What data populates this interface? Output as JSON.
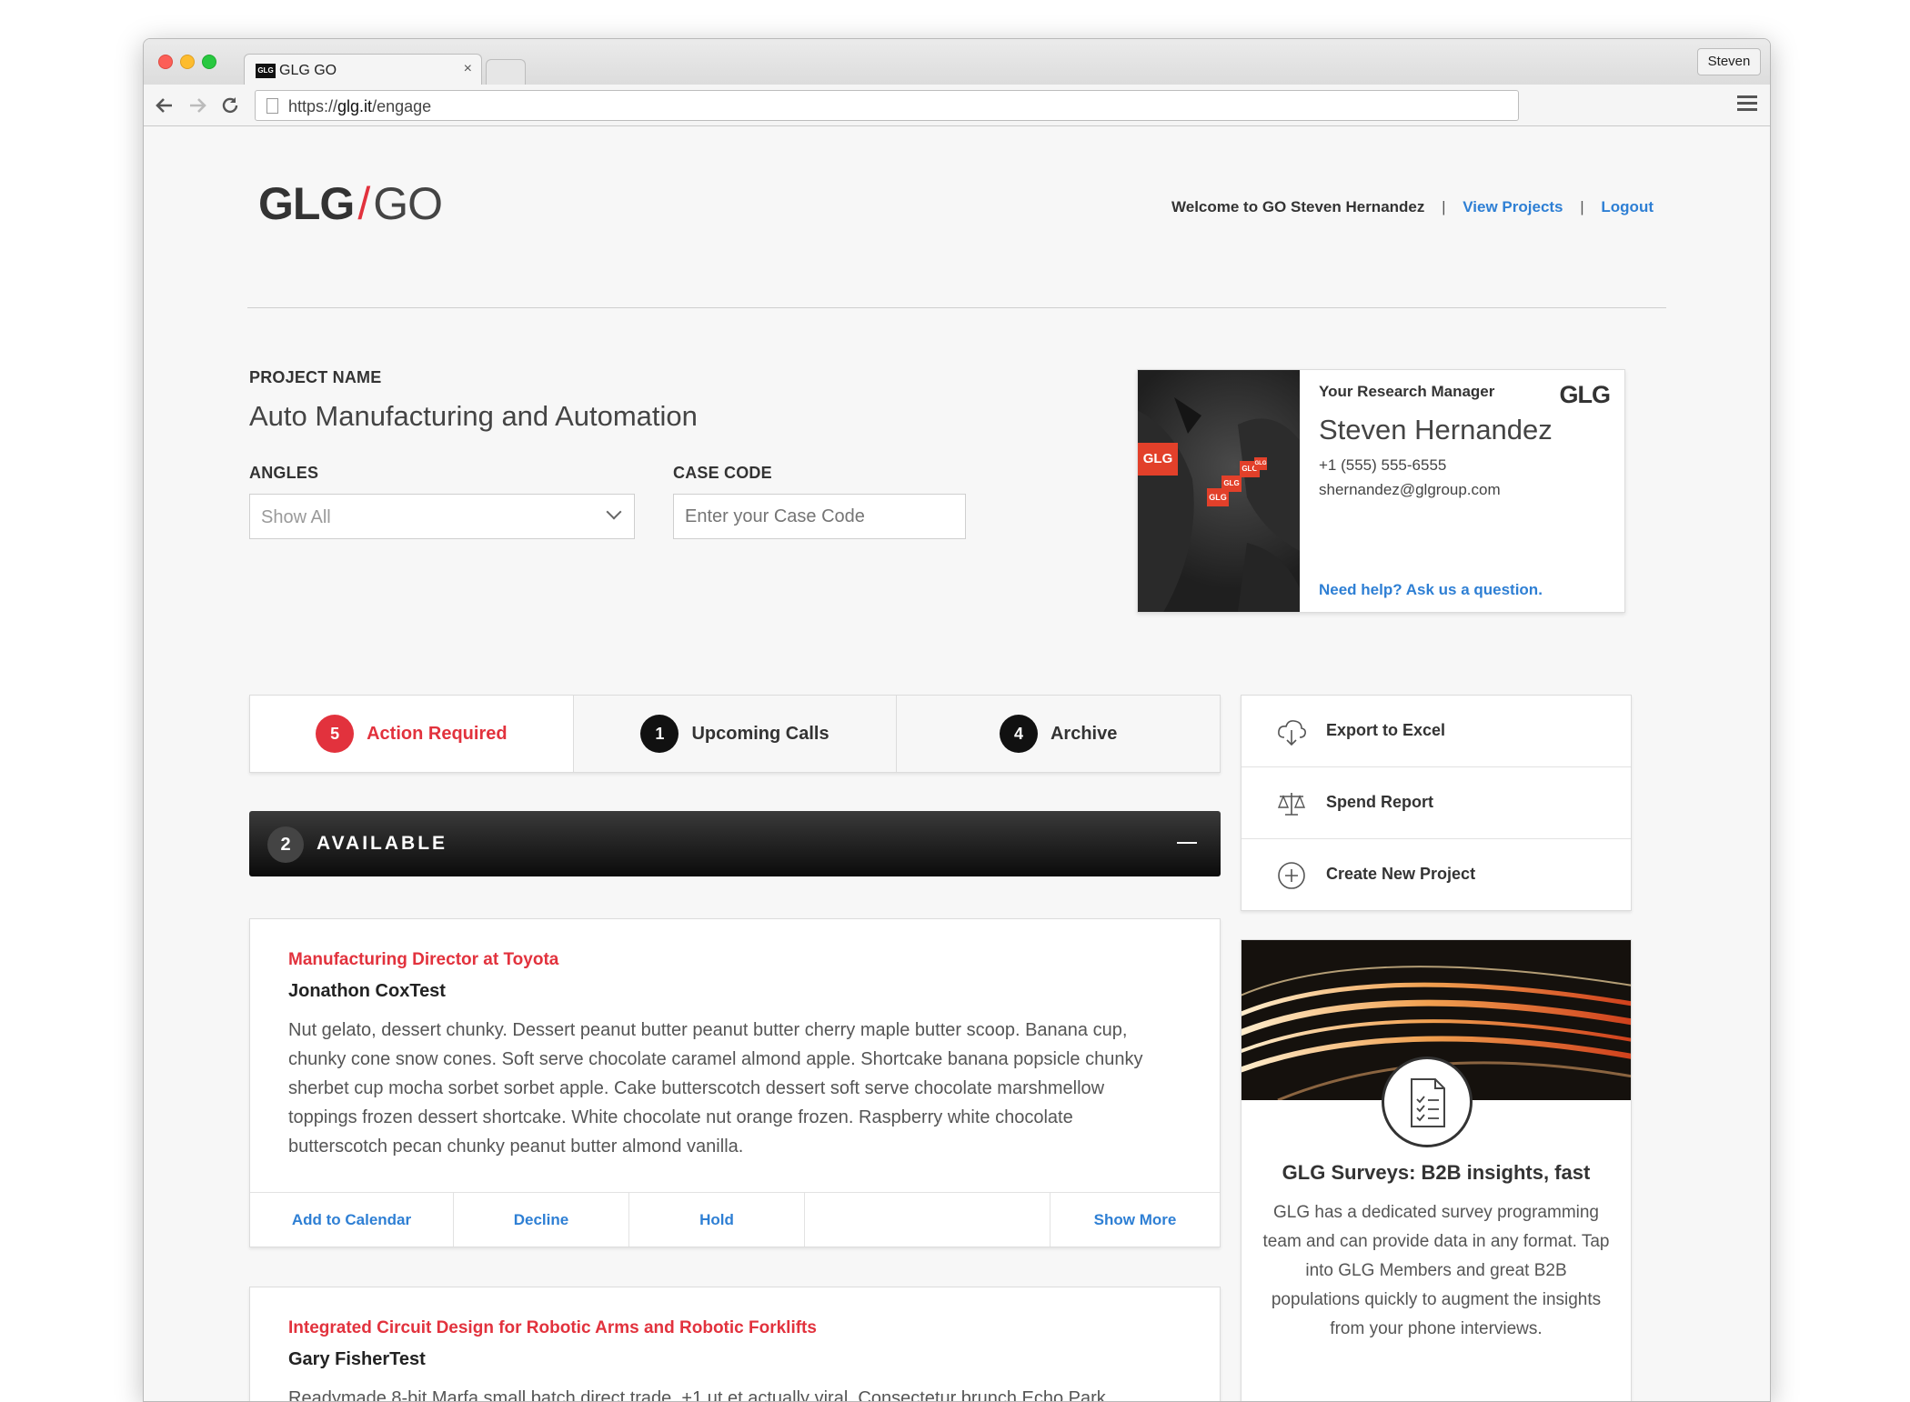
{
  "browser": {
    "tab_favicon": "GLG",
    "tab_title": "GLG GO",
    "tab_close": "×",
    "user_button": "Steven",
    "url_prefix": "https://",
    "url_host": "glg.it",
    "url_path": "/engage"
  },
  "header": {
    "logo_glg": "GLG",
    "logo_slash": "/",
    "logo_go": "GO",
    "welcome": "Welcome to GO Steven Hernandez",
    "sep": "|",
    "view_projects": "View Projects",
    "logout": "Logout"
  },
  "project": {
    "name_label": "PROJECT NAME",
    "name_value": "Auto Manufacturing and Automation",
    "angles_label": "ANGLES",
    "angles_value": "Show All",
    "case_code_label": "CASE CODE",
    "case_code_placeholder": "Enter your Case Code"
  },
  "research_manager": {
    "title": "Your Research Manager",
    "logo": "GLG",
    "pin_label": "GLG",
    "name": "Steven Hernandez",
    "phone": "+1 (555) 555-6555",
    "email": "shernandez@glgroup.com",
    "help_link": "Need help? Ask us a question."
  },
  "tabs": [
    {
      "count": "5",
      "label": "Action Required"
    },
    {
      "count": "1",
      "label": "Upcoming Calls"
    },
    {
      "count": "4",
      "label": "Archive"
    }
  ],
  "available": {
    "count": "2",
    "title": "AVAILABLE"
  },
  "cards": [
    {
      "role": "Manufacturing Director at Toyota",
      "name": "Jonathon CoxTest",
      "description": "Nut gelato, dessert chunky. Dessert peanut butter peanut butter cherry maple butter scoop. Banana cup, chunky cone snow cones. Soft serve chocolate caramel almond apple. Shortcake banana popsicle chunky sherbet cup mocha sorbet sorbet apple. Cake butterscotch dessert soft serve chocolate marshmellow toppings frozen dessert shortcake. White chocolate nut orange frozen. Raspberry white chocolate butterscotch pecan chunky peanut butter almond vanilla.",
      "actions": {
        "add_calendar": "Add to Calendar",
        "decline": "Decline",
        "hold": "Hold",
        "show_more": "Show More"
      }
    },
    {
      "role": "Integrated Circuit Design for Robotic Arms and Robotic Forklifts",
      "name": "Gary FisherTest",
      "description": "Readymade 8-bit Marfa small batch direct trade, +1 ut et actually viral. Consectetur brunch Echo Park"
    }
  ],
  "side_actions": [
    {
      "icon": "cloud-download-icon",
      "label": "Export to Excel"
    },
    {
      "icon": "scale-icon",
      "label": "Spend Report"
    },
    {
      "icon": "plus-circle-icon",
      "label": "Create New Project"
    }
  ],
  "promo": {
    "title": "GLG Surveys: B2B insights, fast",
    "text": "GLG has a dedicated survey programming team and can provide data in any format. Tap into GLG Members and great B2B populations quickly to augment the insights from your phone interviews."
  },
  "colors": {
    "accent_red": "#e2323d",
    "link_blue": "#2e7fd4",
    "dark": "#111111"
  }
}
